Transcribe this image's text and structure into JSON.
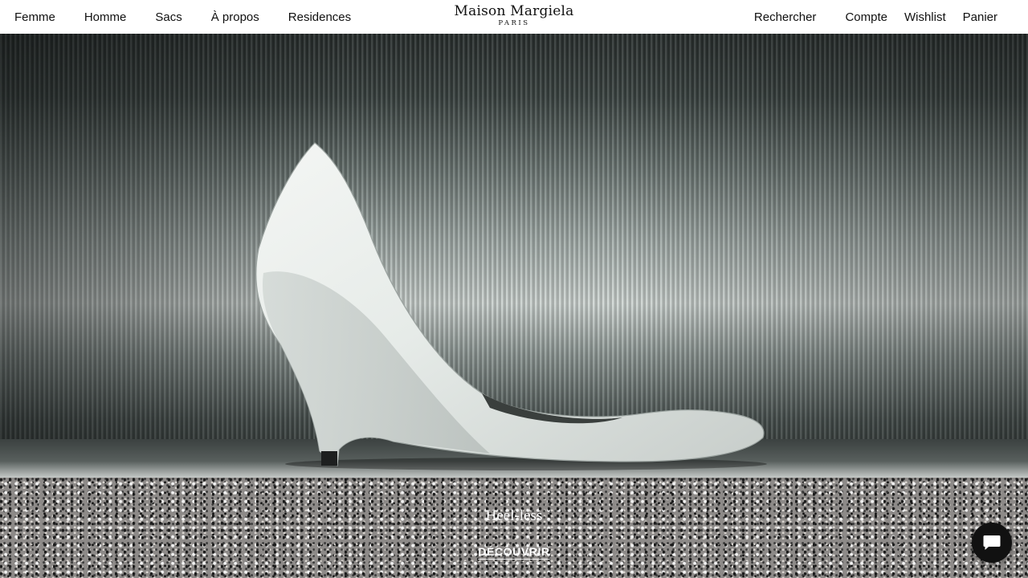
{
  "header": {
    "nav_left": [
      "Femme",
      "Homme",
      "Sacs",
      "À propos",
      "Residences"
    ],
    "logo": {
      "main": "Maison Margiela",
      "sub": "PARIS"
    },
    "nav_right": [
      "Rechercher",
      "Compte",
      "Wishlist",
      "Panier"
    ]
  },
  "hero": {
    "caption": "Heel-less",
    "cta_label": "DÉCOUVRIR"
  },
  "chat": {
    "icon": "chat-bubble-icon"
  },
  "colors": {
    "header_bg": "#ffffff",
    "text": "#111111",
    "hero_text": "#ffffff",
    "chat_bg": "#111111"
  }
}
